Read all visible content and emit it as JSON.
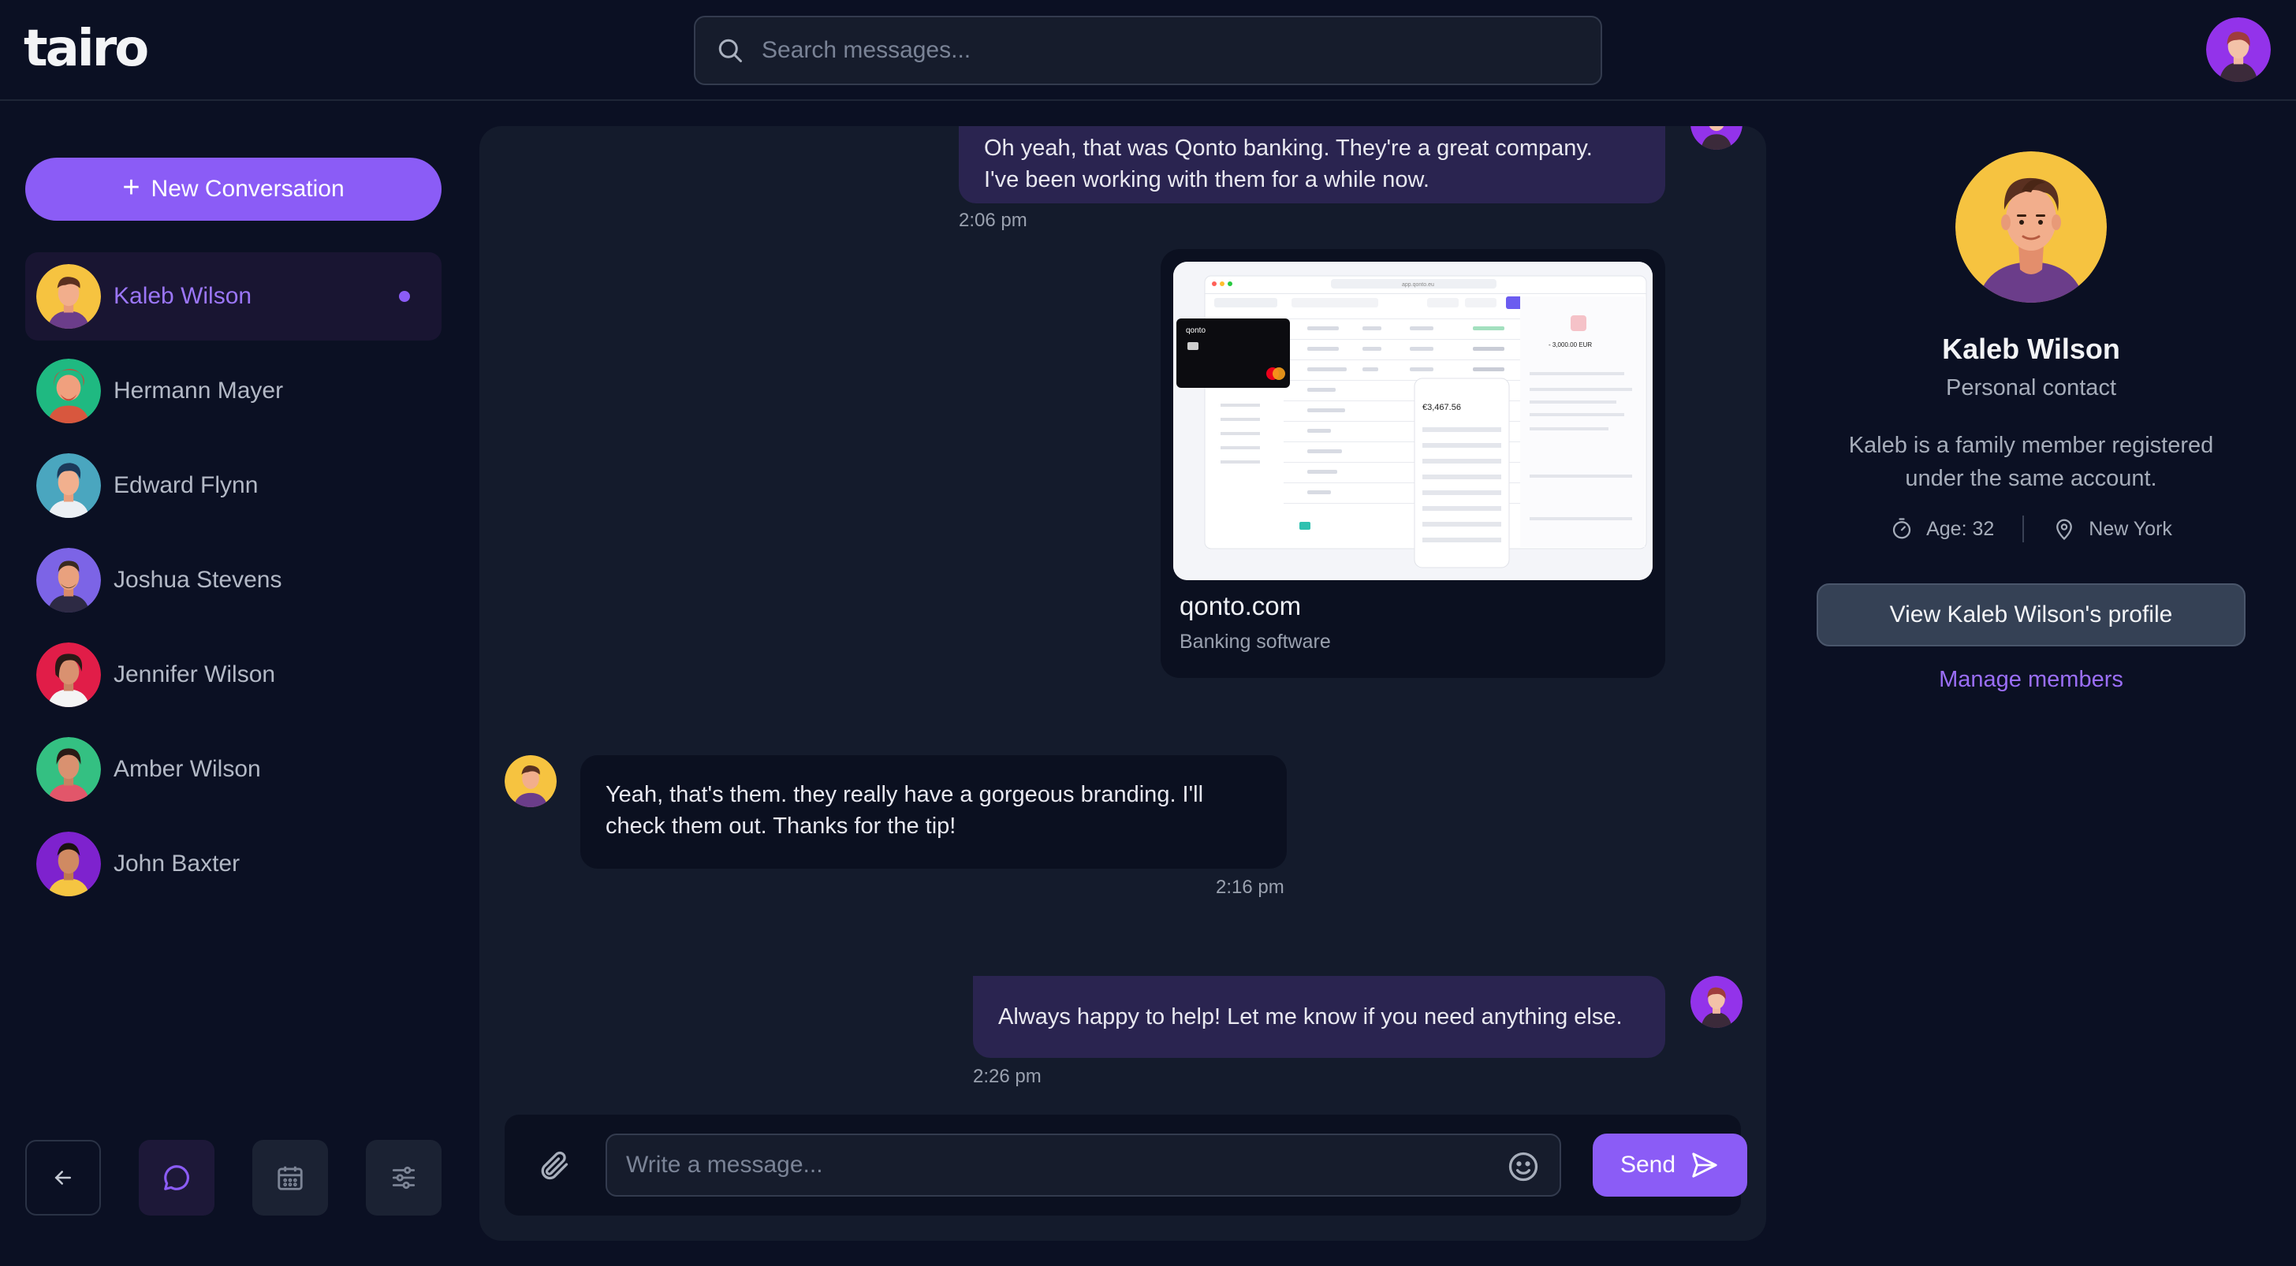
{
  "app": {
    "logo": "tairo"
  },
  "search": {
    "placeholder": "Search messages..."
  },
  "sidebar": {
    "new_conversation": "New Conversation",
    "contacts": [
      {
        "name": "Kaleb Wilson",
        "active": true,
        "unread": true
      },
      {
        "name": "Hermann Mayer"
      },
      {
        "name": "Edward Flynn"
      },
      {
        "name": "Joshua Stevens"
      },
      {
        "name": "Jennifer Wilson"
      },
      {
        "name": "Amber Wilson"
      },
      {
        "name": "John Baxter"
      }
    ],
    "nav_icons": [
      "arrow-left-icon",
      "chat-bubble-icon",
      "calendar-icon",
      "sliders-icon"
    ]
  },
  "chat": {
    "messages": [
      {
        "direction": "out",
        "text_line1": "Oh yeah, that was Qonto banking. They're a great company.",
        "text_line2": "I've been working with them for a while now.",
        "time": "2:06 pm"
      },
      {
        "direction": "out",
        "type": "link",
        "domain": "qonto.com",
        "description": "Banking software"
      },
      {
        "direction": "in",
        "text_line1": "Yeah, that's them. they really have a gorgeous branding. I'll",
        "text_line2": "check them out. Thanks for the tip!",
        "time": "2:16 pm"
      },
      {
        "direction": "out",
        "text_line1": "Always happy to help! Let me know if you need anything else.",
        "time": "2:26 pm"
      }
    ],
    "composer": {
      "placeholder": "Write a message...",
      "send_label": "Send"
    }
  },
  "profile": {
    "name": "Kaleb Wilson",
    "role": "Personal contact",
    "description": "Kaleb is a family member registered under the same account.",
    "age": "Age: 32",
    "location": "New York",
    "view_profile": "View Kaleb Wilson's profile",
    "manage_members": "Manage members"
  },
  "preview_screen": {
    "card_brand": "qonto",
    "balance": "€3,467.56",
    "amount": "- 3,000.00 EUR",
    "url": "app.qonto.eu"
  },
  "colors": {
    "accent": "#8b5cf6",
    "background": "#0b1023",
    "panel": "#141b2c",
    "bubble_out": "#2a2450"
  }
}
